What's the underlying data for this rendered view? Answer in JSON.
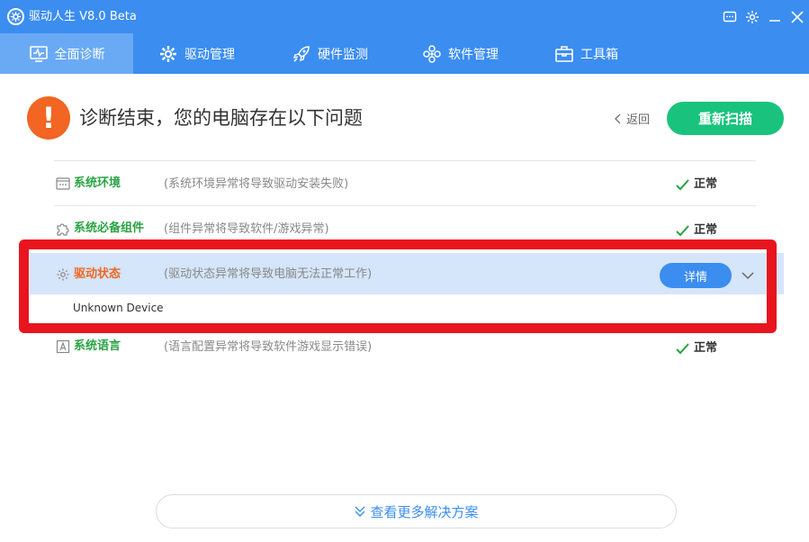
{
  "window": {
    "title": "驱动人生 V8.0 Beta"
  },
  "nav": {
    "tabs": [
      {
        "label": "全面诊断",
        "icon": "monitor-pulse-icon",
        "active": true
      },
      {
        "label": "驱动管理",
        "icon": "gear-icon",
        "active": false
      },
      {
        "label": "硬件监测",
        "icon": "rocket-icon",
        "active": false
      },
      {
        "label": "软件管理",
        "icon": "flower-icon",
        "active": false
      },
      {
        "label": "工具箱",
        "icon": "toolbox-icon",
        "active": false
      }
    ]
  },
  "header": {
    "alert_symbol": "!",
    "headline": "诊断结束，您的电脑存在以下问题",
    "back_label": "返回",
    "rescan_label": "重新扫描"
  },
  "rows": [
    {
      "title": "系统环境",
      "desc": "(系统环境异常将导致驱动安装失败)",
      "status": "正常",
      "icon": "window-icon"
    },
    {
      "title": "系统必备组件",
      "desc": "(组件异常将导致软件/游戏异常)",
      "status": "正常",
      "icon": "puzzle-icon"
    },
    {
      "title": "驱动状态",
      "desc": "(驱动状态异常将导致电脑无法正常工作)",
      "detail_label": "详情",
      "icon": "gear-icon",
      "devices": [
        "Unknown Device"
      ]
    },
    {
      "title": "系统语言",
      "desc": "(语言配置异常将导致软件游戏显示错误)",
      "status": "正常",
      "icon": "letter-a-icon"
    }
  ],
  "footer": {
    "more_label": "查看更多解决方案"
  },
  "colors": {
    "brand_blue": "#3b8df0",
    "ok_green": "#2aa344",
    "scan_green": "#19c37d",
    "warning_orange": "#f26522",
    "highlight_red": "#e8141e"
  }
}
